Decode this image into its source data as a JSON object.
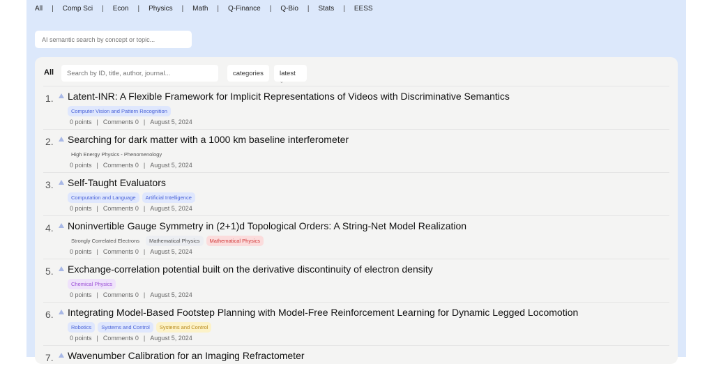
{
  "nav": [
    "All",
    "Comp Sci",
    "Econ",
    "Physics",
    "Math",
    "Q-Finance",
    "Q-Bio",
    "Stats",
    "EESS"
  ],
  "ai_search": {
    "placeholder": "AI semantic search by concept or topic..."
  },
  "toolbar": {
    "all_label": "All",
    "search_placeholder": "Search by ID, title, author, journal...",
    "categories_label": "categories",
    "sort_label": "latest"
  },
  "colors": {
    "blue": "#dfe7fd",
    "blue_text": "#4a63d8",
    "red": "#fbdcdc",
    "red_text": "#d23b3b",
    "purple": "#efe2fb",
    "purple_text": "#9b4fd6",
    "yellow": "#fcf2c8",
    "yellow_text": "#b8891a",
    "gray_text": "#555"
  },
  "papers": [
    {
      "rank": "1.",
      "title": "Latent-INR: A Flexible Framework for Implicit Representations of Videos with Discriminative Semantics",
      "tags": [
        {
          "label": "Computer Vision and Pattern Recognition",
          "style": "blue"
        }
      ],
      "points": "0 points",
      "comments": "Comments 0",
      "date": "August 5, 2024"
    },
    {
      "rank": "2.",
      "title": "Searching for dark matter with a 1000 km baseline interferometer",
      "tags": [
        {
          "label": "High Energy Physics - Phenomenology",
          "style": "gray"
        }
      ],
      "points": "0 points",
      "comments": "Comments 0",
      "date": "August 5, 2024"
    },
    {
      "rank": "3.",
      "title": "Self-Taught Evaluators",
      "tags": [
        {
          "label": "Computation and Language",
          "style": "blue"
        },
        {
          "label": "Artificial Intelligence",
          "style": "blue"
        }
      ],
      "points": "0 points",
      "comments": "Comments 0",
      "date": "August 5, 2024"
    },
    {
      "rank": "4.",
      "title": "Noninvertible Gauge Symmetry in (2+1)d Topological Orders: A String-Net Model Realization",
      "tags": [
        {
          "label": "Strongly Correlated Electrons",
          "style": "gray"
        },
        {
          "label": "Mathematical Physics",
          "style": "slate"
        },
        {
          "label": "Mathematical Physics",
          "style": "red"
        }
      ],
      "points": "0 points",
      "comments": "Comments 0",
      "date": "August 5, 2024"
    },
    {
      "rank": "5.",
      "title": "Exchange-correlation potential built on the derivative discontinuity of electron density",
      "tags": [
        {
          "label": "Chemical Physics",
          "style": "purple"
        }
      ],
      "points": "0 points",
      "comments": "Comments 0",
      "date": "August 5, 2024"
    },
    {
      "rank": "6.",
      "title": "Integrating Model-Based Footstep Planning with Model-Free Reinforcement Learning for Dynamic Legged Locomotion",
      "tags": [
        {
          "label": "Robotics",
          "style": "blue"
        },
        {
          "label": "Systems and Control",
          "style": "blue"
        },
        {
          "label": "Systems and Control",
          "style": "yellow"
        }
      ],
      "points": "0 points",
      "comments": "Comments 0",
      "date": "August 5, 2024"
    },
    {
      "rank": "7.",
      "title": "Wavenumber Calibration for an Imaging Refractometer",
      "tags": [],
      "points": "",
      "comments": "",
      "date": ""
    }
  ]
}
